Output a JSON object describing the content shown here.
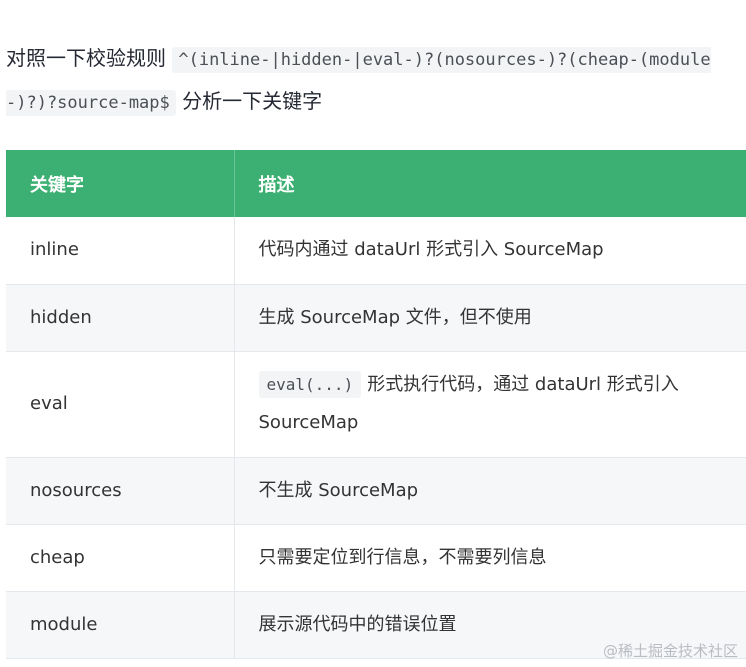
{
  "intro": {
    "lead": "对照一下校验规则 ",
    "regex": "^(inline-|hidden-|eval-)?(nosources-)?(cheap-(module-)?)?source-map$",
    "tail": " 分析一下关键字"
  },
  "table": {
    "headers": {
      "keyword": "关键字",
      "description": "描述"
    },
    "rows": [
      {
        "keyword": "inline",
        "description": "代码内通过 dataUrl 形式引入 SourceMap"
      },
      {
        "keyword": "hidden",
        "description": "生成 SourceMap 文件，但不使用"
      },
      {
        "keyword": "eval",
        "code": "eval(...)",
        "description": "形式执行代码，通过 dataUrl 形式引入 SourceMap"
      },
      {
        "keyword": "nosources",
        "description": "不生成 SourceMap"
      },
      {
        "keyword": "cheap",
        "description": "只需要定位到行信息，不需要列信息"
      },
      {
        "keyword": "module",
        "description": "展示源代码中的错误位置"
      }
    ]
  },
  "watermark": "@稀土掘金技术社区",
  "colors": {
    "header_bg": "#3cb072",
    "header_text": "#ffffff",
    "code_bg": "#f3f4f5",
    "stripe_bg": "#f6f7f9"
  }
}
